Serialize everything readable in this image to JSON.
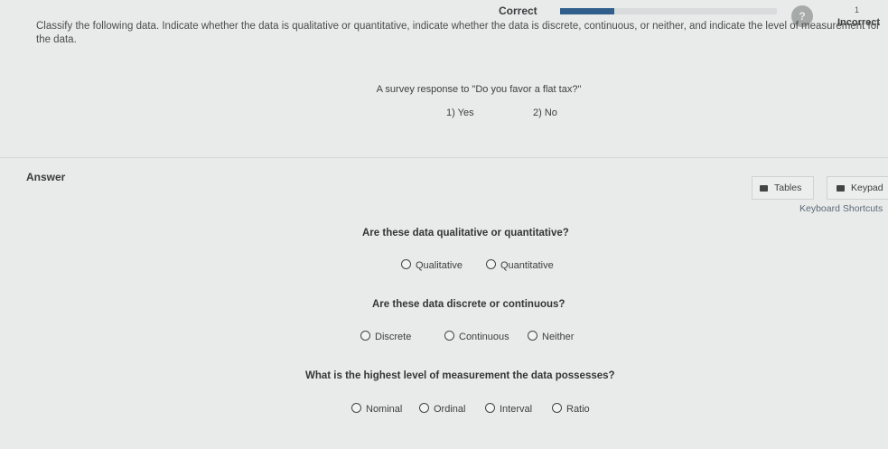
{
  "header": {
    "correct_label": "Correct",
    "progress": 0.25,
    "help_glyph": "?",
    "incorrect_count": "1",
    "incorrect_label": "Incorrect"
  },
  "problem": {
    "instructions": "Classify the following data. Indicate whether the data is qualitative or quantitative, indicate whether the data is discrete, continuous, or neither, and indicate the level of measurement for the data.",
    "prompt": "A survey response to \"Do you favor a flat tax?\"",
    "choices": [
      "1) Yes",
      "2) No"
    ]
  },
  "answer": {
    "label": "Answer",
    "tables_button": "Tables",
    "keypad_button": "Keypad",
    "keyboard_shortcuts_link": "Keyboard Shortcuts"
  },
  "questions": [
    {
      "heading": "Are these data qualitative or quantitative?",
      "options": [
        "Qualitative",
        "Quantitative"
      ]
    },
    {
      "heading": "Are these data discrete or continuous?",
      "options": [
        "Discrete",
        "Continuous",
        "Neither"
      ]
    },
    {
      "heading": "What is the highest level of measurement the data possesses?",
      "options": [
        "Nominal",
        "Ordinal",
        "Interval",
        "Ratio"
      ]
    }
  ]
}
